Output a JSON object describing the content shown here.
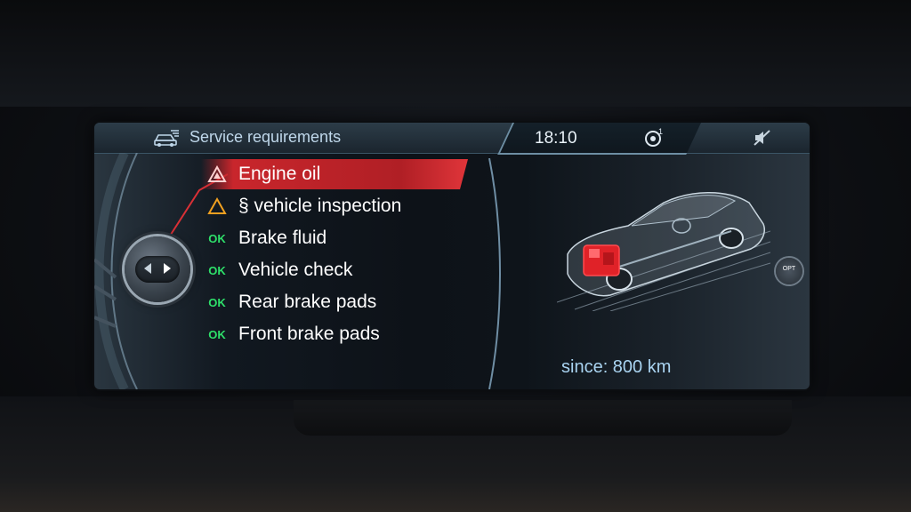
{
  "header": {
    "title": "Service requirements",
    "clock": "18:10",
    "icons": [
      "service-icon",
      "tmc-icon",
      "mute-icon"
    ]
  },
  "service_items": [
    {
      "label": "Engine oil",
      "status": "red-warning",
      "status_icon": "red-warning-triangle-icon",
      "selected": true
    },
    {
      "label": "§ vehicle inspection",
      "status": "yellow-warning",
      "status_icon": "yellow-warning-triangle-icon",
      "selected": false
    },
    {
      "label": "Brake fluid",
      "status": "OK",
      "selected": false
    },
    {
      "label": "Vehicle check",
      "status": "OK",
      "selected": false
    },
    {
      "label": "Rear brake pads",
      "status": "OK",
      "selected": false
    },
    {
      "label": "Front brake pads",
      "status": "OK",
      "selected": false
    }
  ],
  "detail": {
    "since": "since: 800 km",
    "option_button": "OPT"
  },
  "colors": {
    "selection_red": "#c8262c",
    "ok_green": "#2ee06a",
    "warning_yellow": "#f0a020",
    "header_text": "#bfd7ea",
    "since_text": "#a9d3f0"
  }
}
